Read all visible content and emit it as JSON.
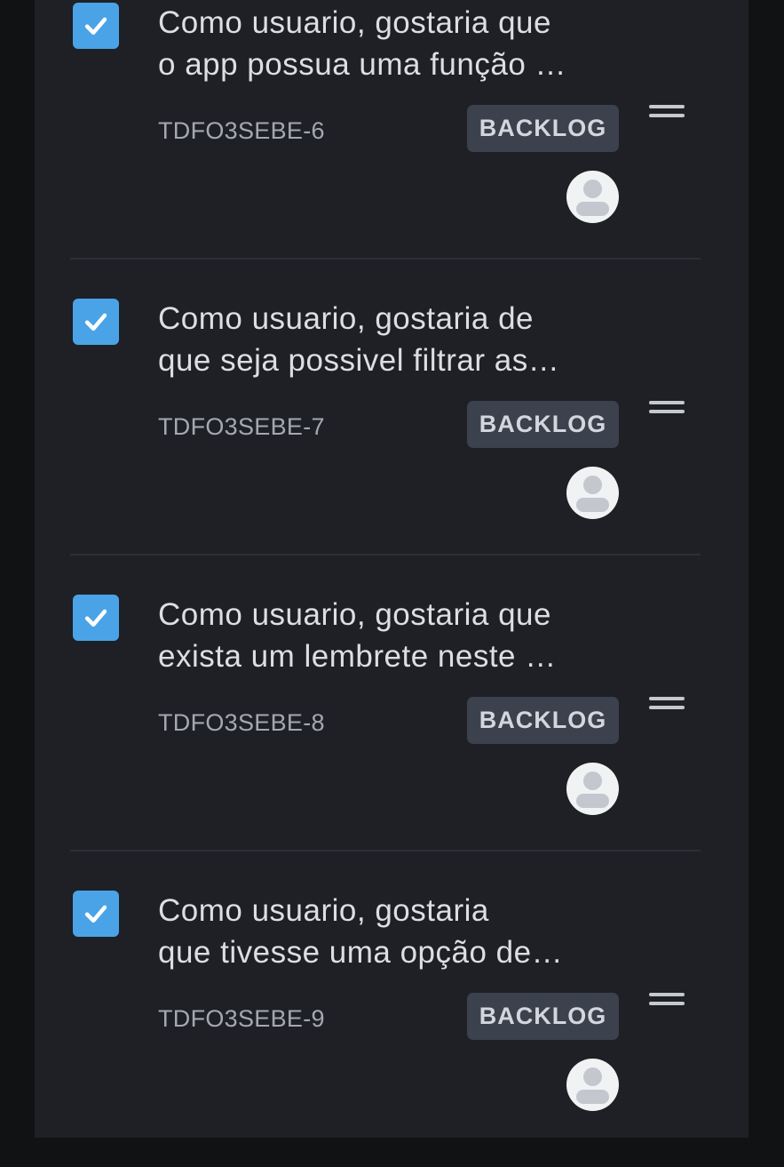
{
  "issues": [
    {
      "summary_line1": "Como usuario, gostaria que",
      "summary_line2": "o app possua uma função …",
      "key": "TDFO3SEBE-6",
      "status": "BACKLOG",
      "checked": true
    },
    {
      "summary_line1": "Como usuario, gostaria de",
      "summary_line2": "que seja possivel filtrar as…",
      "key": "TDFO3SEBE-7",
      "status": "BACKLOG",
      "checked": true
    },
    {
      "summary_line1": "Como usuario, gostaria que",
      "summary_line2": "exista um lembrete neste …",
      "key": "TDFO3SEBE-8",
      "status": "BACKLOG",
      "checked": true
    },
    {
      "summary_line1": "Como usuario, gostaria",
      "summary_line2": "que tivesse uma opção de…",
      "key": "TDFO3SEBE-9",
      "status": "BACKLOG",
      "checked": true
    }
  ],
  "icons": {
    "checkbox": "check-icon",
    "drag": "drag-handle-icon",
    "avatar": "user-avatar-icon"
  },
  "colors": {
    "checkbox": "#4aa3e6",
    "status_badge_bg": "#3b424d",
    "panel_bg": "#1e2025"
  }
}
